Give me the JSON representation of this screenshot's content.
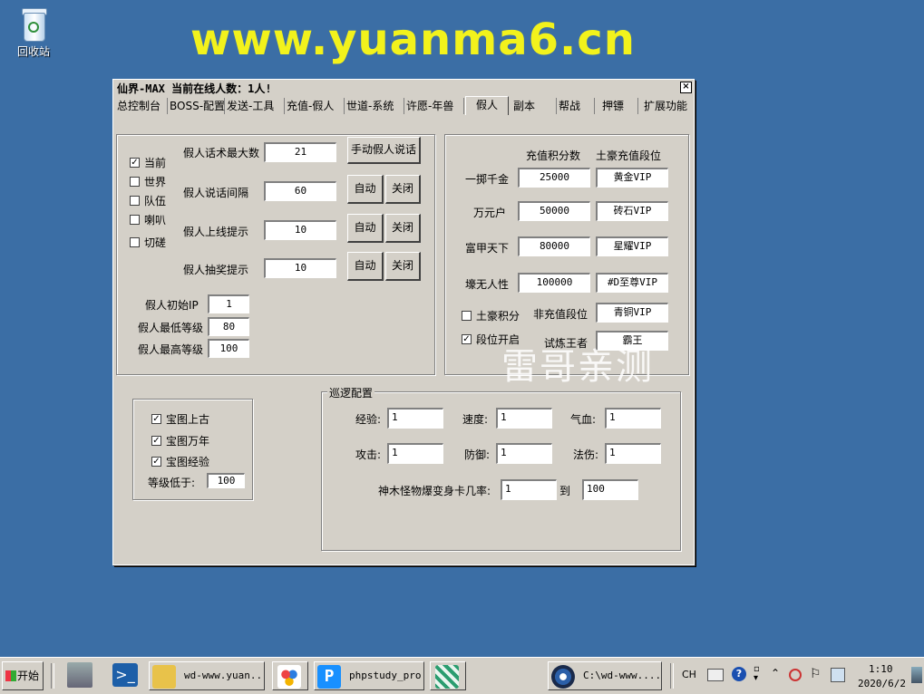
{
  "desktop": {
    "recycle_bin_label": "回收站",
    "banner": "www.yuanma6.cn"
  },
  "window": {
    "title": "仙界-MAX  当前在线人数：1人!",
    "close": "×",
    "tabs": [
      "总控制台",
      "BOSS-配置",
      "发送-工具",
      "充值-假人",
      "世道-系统",
      "许愿-年兽",
      "假人",
      "副本",
      "帮战",
      "押镖",
      "扩展功能"
    ],
    "active_tab": "假人"
  },
  "fake_chat": {
    "channels": [
      {
        "label": "当前",
        "checked": true
      },
      {
        "label": "世界",
        "checked": false
      },
      {
        "label": "队伍",
        "checked": false
      },
      {
        "label": "喇叭",
        "checked": false
      },
      {
        "label": "切磋",
        "checked": false
      }
    ],
    "max_speech_label": "假人话术最大数",
    "max_speech_value": "21",
    "manual_speak_button": "手动假人说话",
    "interval_label": "假人说话间隔",
    "interval_value": "60",
    "online_label": "假人上线提示",
    "online_value": "10",
    "lottery_label": "假人抽奖提示",
    "lottery_value": "10",
    "auto_label": "自动",
    "close_label": "关闭",
    "initial_ip_label": "假人初始IP",
    "initial_ip_value": "1",
    "min_level_label": "假人最低等级",
    "min_level_value": "80",
    "max_level_label": "假人最高等级",
    "max_level_value": "100"
  },
  "recharge": {
    "col_points": "充值积分数",
    "col_rank": "土豪充值段位",
    "rows": [
      {
        "name": "一掷千金",
        "points": "25000",
        "rank": "黄金VIP"
      },
      {
        "name": "万元户",
        "points": "50000",
        "rank": "砖石VIP"
      },
      {
        "name": "富甲天下",
        "points": "80000",
        "rank": "星耀VIP"
      },
      {
        "name": "壕无人性",
        "points": "100000",
        "rank": "#D至尊VIP"
      }
    ],
    "tycoon_points_label": "土豪积分",
    "non_recharge_label": "非充值段位",
    "non_recharge_value": "青铜VIP",
    "rank_open_label": "段位开启",
    "trial_label": "试炼王者",
    "trial_value": "霸王",
    "watermark": "雷哥亲测"
  },
  "treasure": {
    "items": [
      {
        "label": "宝图上古",
        "checked": true
      },
      {
        "label": "宝图万年",
        "checked": true
      },
      {
        "label": "宝图经验",
        "checked": true
      }
    ],
    "level_below_label": "等级低于:",
    "level_below_value": "100"
  },
  "patrol": {
    "title": "巡逻配置",
    "exp_label": "经验:",
    "exp_value": "1",
    "speed_label": "速度:",
    "speed_value": "1",
    "hp_label": "气血:",
    "hp_value": "1",
    "atk_label": "攻击:",
    "atk_value": "1",
    "def_label": "防御:",
    "def_value": "1",
    "magic_label": "法伤:",
    "magic_value": "1",
    "card_rate_label": "神木怪物爆变身卡几率:",
    "card_rate_from": "1",
    "to_label": "到",
    "card_rate_to": "100"
  },
  "taskbar": {
    "start": "开始",
    "items": [
      "wd-www.yuan...",
      "phpstudy_pro",
      "C:\\wd-www...."
    ],
    "lang": "CH",
    "time": "1:10",
    "date": "2020/6/2"
  },
  "colors": {
    "desktop": "#3b6ea5",
    "banner": "#f2f21c",
    "face": "#d4d0c8"
  }
}
